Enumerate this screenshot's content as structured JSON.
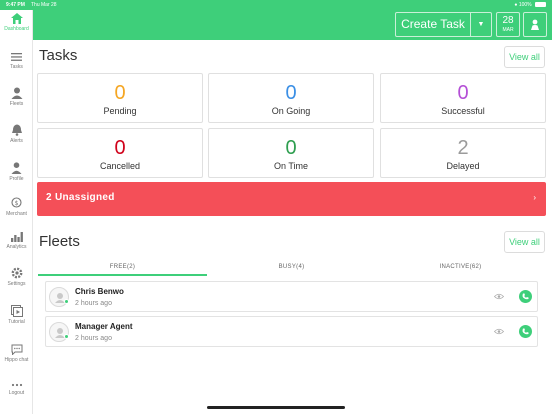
{
  "status_bar": {
    "time": "9:47 PM",
    "date": "Thu Mar 28",
    "battery": "100%"
  },
  "header": {
    "create_task_label": "Create Task",
    "date_day": "28",
    "date_month": "MAR"
  },
  "sidebar": {
    "items": [
      {
        "label": "Dashboard",
        "icon": "home-icon"
      },
      {
        "label": "Tasks",
        "icon": "list-icon"
      },
      {
        "label": "Fleets",
        "icon": "fleet-icon"
      },
      {
        "label": "Alerts",
        "icon": "bell-icon"
      },
      {
        "label": "Profile",
        "icon": "person-icon"
      },
      {
        "label": "Merchant",
        "icon": "merchant-icon"
      },
      {
        "label": "Analytics",
        "icon": "analytics-icon"
      },
      {
        "label": "Settings",
        "icon": "gear-icon"
      },
      {
        "label": "Tutorial",
        "icon": "tutorial-icon"
      },
      {
        "label": "Hippo chat",
        "icon": "chat-icon"
      },
      {
        "label": "Logout",
        "icon": "more-icon"
      }
    ]
  },
  "tasks": {
    "title": "Tasks",
    "view_all": "View all",
    "cards": [
      {
        "value": "0",
        "label": "Pending",
        "color": "#f5a623"
      },
      {
        "value": "0",
        "label": "On Going",
        "color": "#3b8fe5"
      },
      {
        "value": "0",
        "label": "Successful",
        "color": "#b44fd6"
      },
      {
        "value": "0",
        "label": "Cancelled",
        "color": "#d0021b"
      },
      {
        "value": "0",
        "label": "On Time",
        "color": "#2e9e4f"
      },
      {
        "value": "2",
        "label": "Delayed",
        "color": "#9b9b9b"
      }
    ],
    "unassigned": "2 Unassigned"
  },
  "fleets": {
    "title": "Fleets",
    "view_all": "View all",
    "tabs": [
      {
        "label": "FREE(2)",
        "active": true
      },
      {
        "label": "BUSY(4)",
        "active": false
      },
      {
        "label": "INACTIVE(62)",
        "active": false
      }
    ],
    "agents": [
      {
        "name": "Chris Benwo",
        "time": "2 hours ago"
      },
      {
        "name": "Manager Agent",
        "time": "2 hours ago"
      }
    ]
  },
  "colors": {
    "accent": "#3ecf7a",
    "alert": "#f44f58"
  }
}
